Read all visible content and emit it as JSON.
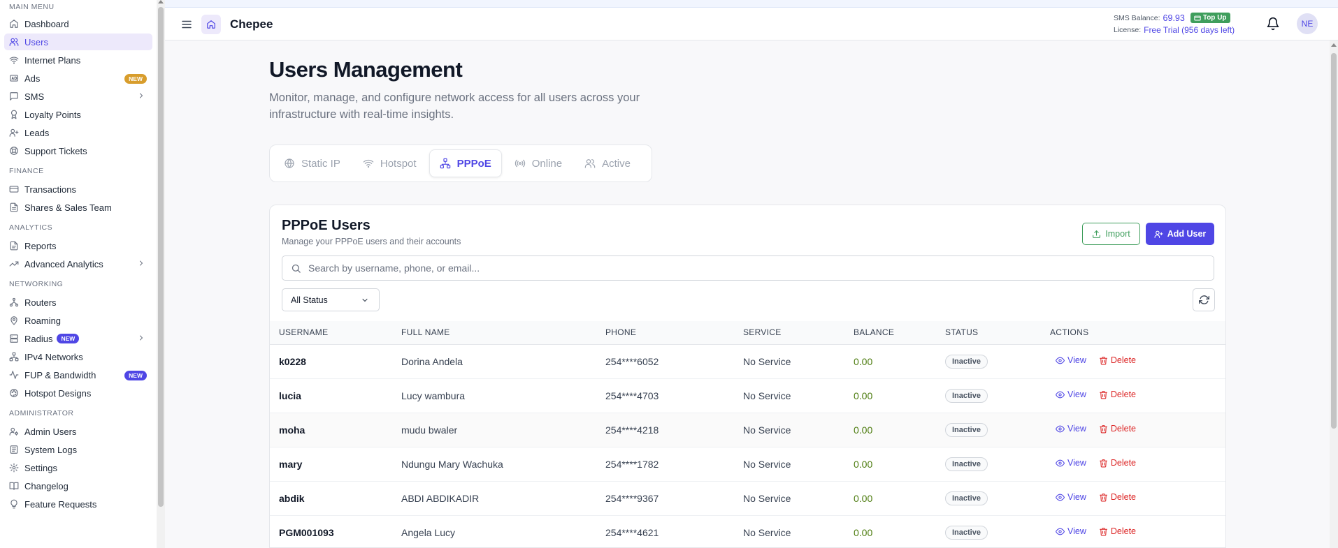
{
  "sidebar": {
    "sections": [
      {
        "title": "MAIN MENU",
        "items": [
          {
            "label": "Dashboard",
            "icon": "home-icon"
          },
          {
            "label": "Users",
            "icon": "users-icon",
            "active": true
          },
          {
            "label": "Internet Plans",
            "icon": "wifi-icon"
          },
          {
            "label": "Ads",
            "icon": "ad-icon",
            "badge": "NEW"
          },
          {
            "label": "SMS",
            "icon": "message-icon",
            "chevron": true
          },
          {
            "label": "Loyalty Points",
            "icon": "award-icon"
          },
          {
            "label": "Leads",
            "icon": "user-plus-icon"
          },
          {
            "label": "Support Tickets",
            "icon": "support-icon"
          }
        ]
      },
      {
        "title": "FINANCE",
        "items": [
          {
            "label": "Transactions",
            "icon": "card-icon"
          },
          {
            "label": "Shares & Sales Team",
            "icon": "file-icon"
          }
        ]
      },
      {
        "title": "ANALYTICS",
        "items": [
          {
            "label": "Reports",
            "icon": "report-icon"
          },
          {
            "label": "Advanced Analytics",
            "icon": "trend-icon",
            "chevron": true
          }
        ]
      },
      {
        "title": "NETWORKING",
        "items": [
          {
            "label": "Routers",
            "icon": "router-icon"
          },
          {
            "label": "Roaming",
            "icon": "location-icon"
          },
          {
            "label": "Radius",
            "icon": "server-icon",
            "badge": "NEW",
            "chevron": true
          },
          {
            "label": "IPv4 Networks",
            "icon": "network-icon"
          },
          {
            "label": "FUP & Bandwidth",
            "icon": "activity-icon",
            "badge": "NEW"
          },
          {
            "label": "Hotspot Designs",
            "icon": "palette-icon"
          }
        ]
      },
      {
        "title": "ADMINISTRATOR",
        "items": [
          {
            "label": "Admin Users",
            "icon": "user-cog-icon"
          },
          {
            "label": "System Logs",
            "icon": "logs-icon"
          },
          {
            "label": "Settings",
            "icon": "gear-icon"
          },
          {
            "label": "Changelog",
            "icon": "book-icon"
          },
          {
            "label": "Feature Requests",
            "icon": "lightbulb-icon"
          }
        ]
      }
    ]
  },
  "header": {
    "brand": "Chepee",
    "sms_label": "SMS Balance:",
    "sms_value": "69.93",
    "topup_label": "Top Up",
    "license_label": "License:",
    "license_value": "Free Trial (956 days left)",
    "avatar_initials": "NE"
  },
  "page": {
    "title": "Users Management",
    "subtitle": "Monitor, manage, and configure network access for all users across your infrastructure with real-time insights."
  },
  "tabs": [
    {
      "label": "Static IP",
      "icon": "globe-icon"
    },
    {
      "label": "Hotspot",
      "icon": "wifi-icon"
    },
    {
      "label": "PPPoE",
      "icon": "network-icon",
      "active": true
    },
    {
      "label": "Online",
      "icon": "broadcast-icon"
    },
    {
      "label": "Active",
      "icon": "users-icon"
    }
  ],
  "card": {
    "title": "PPPoE Users",
    "subtitle": "Manage your PPPoE users and their accounts",
    "import_label": "Import",
    "add_label": "Add User",
    "search_placeholder": "Search by username, phone, or email...",
    "filter_value": "All Status"
  },
  "table": {
    "headers": [
      "USERNAME",
      "FULL NAME",
      "PHONE",
      "SERVICE",
      "BALANCE",
      "STATUS",
      "ACTIONS"
    ],
    "view_label": "View",
    "delete_label": "Delete",
    "rows": [
      {
        "username": "k0228",
        "full_name": "Dorina Andela",
        "phone": "254****6052",
        "service": "No Service",
        "balance": "0.00",
        "status": "Inactive"
      },
      {
        "username": "lucia",
        "full_name": "Lucy wambura",
        "phone": "254****4703",
        "service": "No Service",
        "balance": "0.00",
        "status": "Inactive"
      },
      {
        "username": "moha",
        "full_name": "mudu bwaler",
        "phone": "254****4218",
        "service": "No Service",
        "balance": "0.00",
        "status": "Inactive"
      },
      {
        "username": "mary",
        "full_name": "Ndungu Mary Wachuka",
        "phone": "254****1782",
        "service": "No Service",
        "balance": "0.00",
        "status": "Inactive"
      },
      {
        "username": "abdik",
        "full_name": "ABDI ABDIKADIR",
        "phone": "254****9367",
        "service": "No Service",
        "balance": "0.00",
        "status": "Inactive"
      },
      {
        "username": "PGM001093",
        "full_name": "Angela Lucy",
        "phone": "254****4621",
        "service": "No Service",
        "balance": "0.00",
        "status": "Inactive"
      }
    ]
  },
  "colors": {
    "accent": "#4f46e5",
    "success": "#3f9e5c",
    "danger": "#dc2626",
    "balance": "#4d7c0f"
  }
}
